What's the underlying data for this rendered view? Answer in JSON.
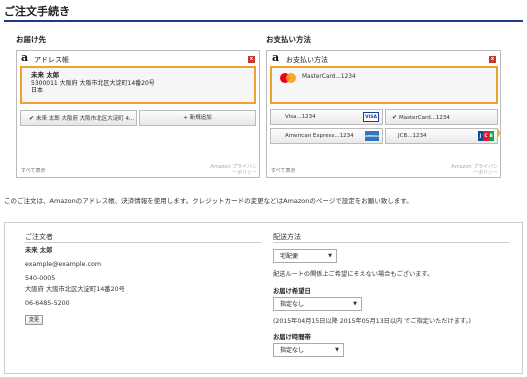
{
  "header": {
    "title": "ご注文手続き"
  },
  "shipping": {
    "section_label": "お届け先",
    "widget_title": "アドレス帳",
    "selected_address": {
      "name": "未来 太郎",
      "line1": "5300011 大阪府 大阪市北区大淀町14番20号",
      "country": "日本"
    },
    "address_option": "未来 太郎 大阪府 大阪市北区大淀町 4...",
    "add_button": "+ 新規追加",
    "show_all": "すべて表示",
    "policy_line1": "Amazon プライバシ",
    "policy_line2": "ーポリシー"
  },
  "payment": {
    "section_label": "お支払い方法",
    "widget_title": "お支払い方法",
    "selected_card": "MasterCard...1234",
    "cards": [
      {
        "label": "Visa...1234",
        "brand": "visa",
        "checked": false
      },
      {
        "label": "MasterCard...1234",
        "brand": "mastercard",
        "checked": true
      },
      {
        "label": "American Express...1234",
        "brand": "amex",
        "checked": false
      },
      {
        "label": "JCB...1234",
        "brand": "jcb",
        "checked": false
      }
    ],
    "brand_text": {
      "visa": "VISA",
      "amex": "AMERICAN EXPRESS",
      "jcb_j": "J",
      "jcb_c": "C",
      "jcb_b": "B"
    },
    "show_all": "すべて表示",
    "policy_line1": "Amazon プライバシ",
    "policy_line2": "ーポリシー"
  },
  "notice": "このご注文は、Amazonのアドレス帳、決済情報を使用します。クレジットカードの変更などはAmazonのページで設定をお願い致します。",
  "orderer": {
    "heading": "ご注文者",
    "name": "未来 太郎",
    "email": "example@example.com",
    "postal": "540-0005",
    "address": "大阪府 大阪市北区大淀町14番20号",
    "phone": "06-6485-5200",
    "change_button": "変更"
  },
  "delivery": {
    "heading": "配送方法",
    "method_value": "宅配便",
    "method_note": "配送ルートの関係上ご希望にそえない場合もございます。",
    "date_label": "お届け希望日",
    "date_value": "指定なし",
    "date_note": "(2015年04月15日以降 2015年05月13日以内 でご指定いただけます。)",
    "time_label": "お届け時間帯",
    "time_value": "指定なし"
  },
  "colors": {
    "title_rule": "#1f3a8c",
    "selected_border": "#f0a030",
    "close_icon": "#c0392b"
  }
}
